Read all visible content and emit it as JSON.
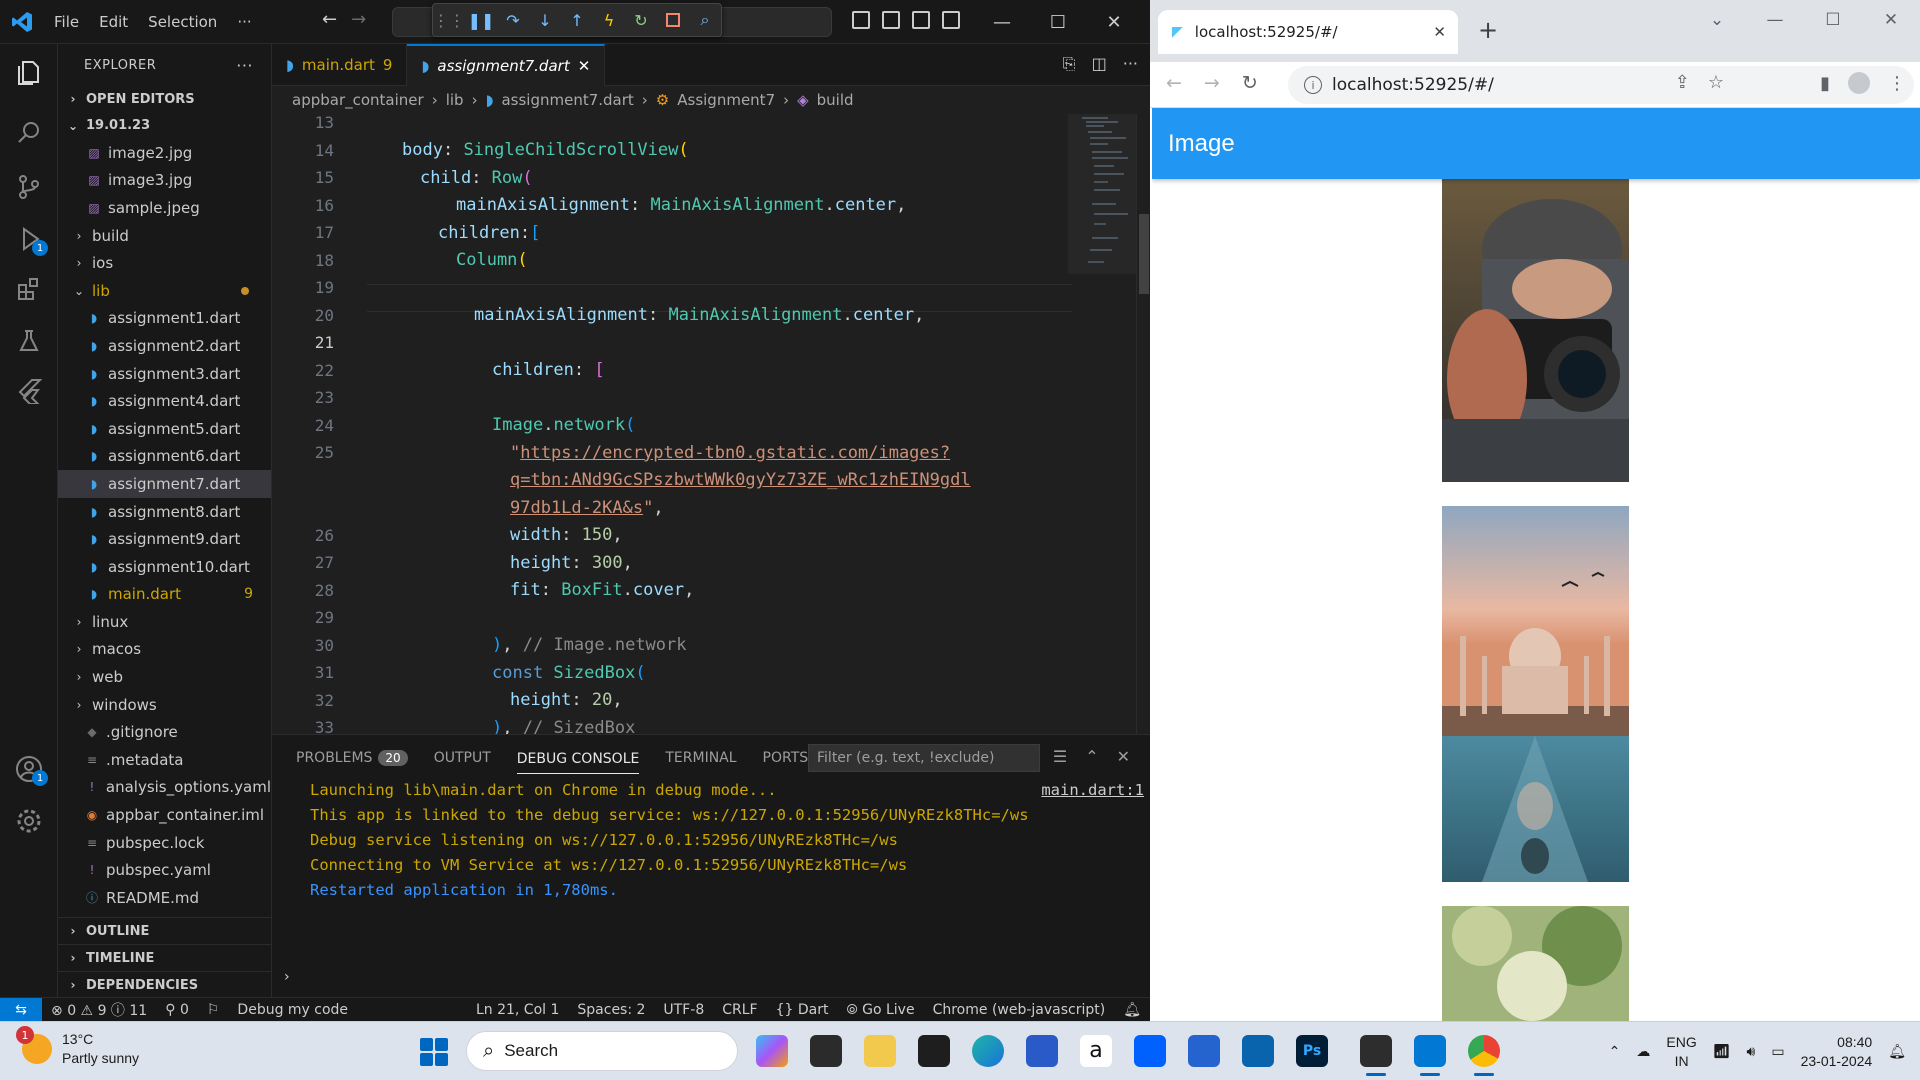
{
  "vscode": {
    "menu": [
      "File",
      "Edit",
      "Selection"
    ],
    "more_menu": "···",
    "explorer_title": "EXPLORER",
    "open_editors": "OPEN EDITORS",
    "folder": "19.01.23",
    "tree": [
      {
        "label": "image2.jpg",
        "type": "image",
        "indent": 2
      },
      {
        "label": "image3.jpg",
        "type": "image",
        "indent": 2
      },
      {
        "label": "sample.jpeg",
        "type": "image",
        "indent": 2
      },
      {
        "label": "build",
        "type": "folder",
        "indent": 1
      },
      {
        "label": "ios",
        "type": "folder",
        "indent": 1
      },
      {
        "label": "lib",
        "type": "folder-open",
        "indent": 1,
        "modified": true
      },
      {
        "label": "assignment1.dart",
        "type": "dart",
        "indent": 2
      },
      {
        "label": "assignment2.dart",
        "type": "dart",
        "indent": 2
      },
      {
        "label": "assignment3.dart",
        "type": "dart",
        "indent": 2
      },
      {
        "label": "assignment4.dart",
        "type": "dart",
        "indent": 2
      },
      {
        "label": "assignment5.dart",
        "type": "dart",
        "indent": 2
      },
      {
        "label": "assignment6.dart",
        "type": "dart",
        "indent": 2
      },
      {
        "label": "assignment7.dart",
        "type": "dart",
        "indent": 2,
        "selected": true
      },
      {
        "label": "assignment8.dart",
        "type": "dart",
        "indent": 2
      },
      {
        "label": "assignment9.dart",
        "type": "dart",
        "indent": 2
      },
      {
        "label": "assignment10.dart",
        "type": "dart",
        "indent": 2
      },
      {
        "label": "main.dart",
        "type": "dart",
        "indent": 2,
        "count": "9",
        "warn": true
      },
      {
        "label": "linux",
        "type": "folder",
        "indent": 1
      },
      {
        "label": "macos",
        "type": "folder",
        "indent": 1
      },
      {
        "label": "web",
        "type": "folder",
        "indent": 1
      },
      {
        "label": "windows",
        "type": "folder",
        "indent": 1
      },
      {
        "label": ".gitignore",
        "type": "git",
        "indent": 1
      },
      {
        "label": ".metadata",
        "type": "plain",
        "indent": 1
      },
      {
        "label": "analysis_options.yaml",
        "type": "yaml",
        "indent": 1
      },
      {
        "label": "appbar_container.iml",
        "type": "rss",
        "indent": 1
      },
      {
        "label": "pubspec.lock",
        "type": "plain",
        "indent": 1
      },
      {
        "label": "pubspec.yaml",
        "type": "yaml",
        "indent": 1
      },
      {
        "label": "README.md",
        "type": "info",
        "indent": 1
      }
    ],
    "outline": "OUTLINE",
    "timeline": "TIMELINE",
    "dependencies": "DEPENDENCIES",
    "tabs": [
      {
        "label": "main.dart",
        "count": "9"
      },
      {
        "label": "assignment7.dart",
        "close": "✕"
      }
    ],
    "breadcrumb": [
      "appbar_container",
      "lib",
      "assignment7.dart",
      "Assignment7",
      "build"
    ],
    "line_numbers": [
      "13",
      "14",
      "15",
      "16",
      "17",
      "18",
      "19",
      "20",
      "21",
      "22",
      "23",
      "24",
      "25",
      "",
      "",
      "26",
      "27",
      "28",
      "29",
      "30",
      "31",
      "32",
      "33"
    ],
    "current_line": "21",
    "panel": {
      "tabs": [
        "PROBLEMS",
        "OUTPUT",
        "DEBUG CONSOLE",
        "TERMINAL",
        "PORTS"
      ],
      "problems_count": "20",
      "filter_placeholder": "Filter (e.g. text, !exclude)",
      "console": [
        "Launching lib\\main.dart on Chrome in debug mode...",
        "This app is linked to the debug service: ws://127.0.0.1:52956/UNyREzk8THc=/ws",
        "Debug service listening on ws://127.0.0.1:52956/UNyREzk8THc=/ws",
        "Connecting to VM Service at ws://127.0.0.1:52956/UNyREzk8THc=/ws",
        "Restarted application in 1,780ms."
      ],
      "source_link": "main.dart:1",
      "prompt": "›"
    },
    "status": {
      "errors": "0",
      "warnings": "9",
      "infos": "11",
      "ports": "0",
      "debug": "Debug my code",
      "position": "Ln 21, Col 1",
      "spaces": "Spaces: 2",
      "encoding": "UTF-8",
      "eol": "CRLF",
      "language": "Dart",
      "golive": "Go Live",
      "device": "Chrome (web-javascript)"
    },
    "badges": {
      "run": "1",
      "account": "1"
    }
  },
  "chrome": {
    "tab_title": "localhost:52925/#/",
    "url": "localhost:52925/#/",
    "app_title": "Image"
  },
  "taskbar": {
    "temperature": "13°C",
    "condition": "Partly sunny",
    "weather_badge": "1",
    "search": "Search",
    "lang1": "ENG",
    "lang2": "IN",
    "time": "08:40",
    "date": "23-01-2024"
  },
  "colors": {
    "vscode_accent": "#0078d4",
    "flutter_appbar": "#2196f3",
    "console_warn": "#cca700",
    "console_info": "#3794ff"
  }
}
